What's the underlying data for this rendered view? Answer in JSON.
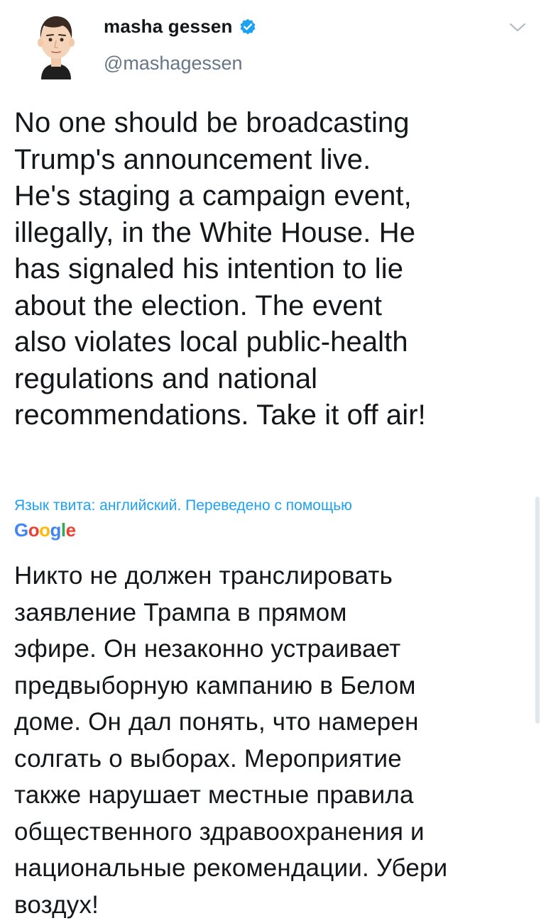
{
  "author": {
    "display_name": "masha gessen",
    "handle": "@mashagessen",
    "verified": true,
    "avatar_icon": "cartoon-avatar-icon"
  },
  "tweet": {
    "text": "No one should be broadcasting\nTrump's announcement live.\nHe's staging a campaign event,\nillegally, in the White House. He\nhas signaled his intention to lie\nabout  the election. The event\nalso violates local public-health\nregulations and national\nrecommendations. Take it off air!"
  },
  "translation": {
    "meta_label": "Язык твита: английский. Переведено с помощью",
    "provider_logo": "Google",
    "text": "Никто не должен транслировать\nзаявление Трампа в прямом\nэфире. Он незаконно устраивает\nпредвыборную кампанию в Белом\nдоме. Он дал понять, что намерен\nсолгать о выборах. Мероприятие\nтакже нарушает местные правила\nобщественного здравоохранения и\nнациональные рекомендации. Убери\nвоздух!"
  },
  "colors": {
    "link_blue": "#1da1f2",
    "handle_gray": "#657786",
    "text_dark": "#14171a",
    "verified_blue": "#1da1f2"
  },
  "icons": {
    "verified": "verified-badge-icon",
    "menu": "chevron-down-icon"
  }
}
